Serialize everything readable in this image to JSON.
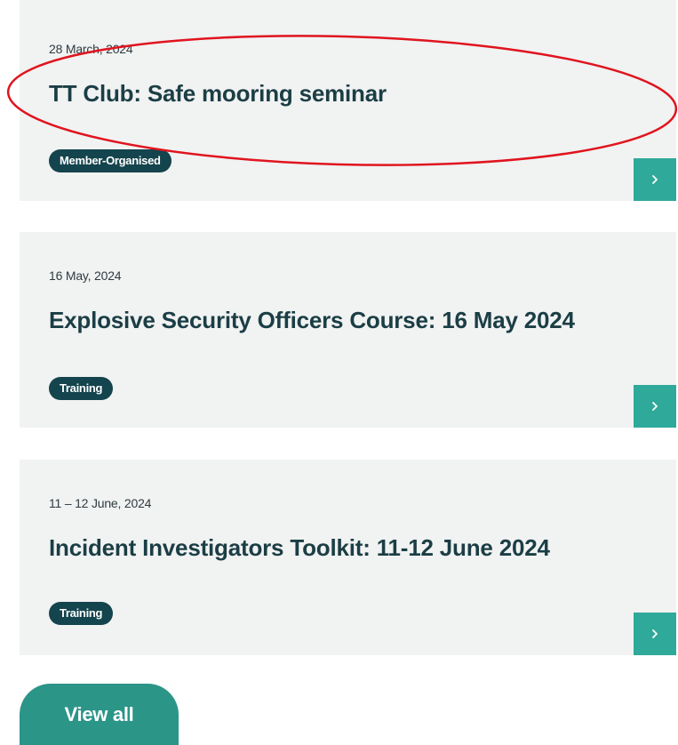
{
  "events": [
    {
      "date": "28 March, 2024",
      "title": "TT Club: Safe mooring seminar",
      "tag": "Member-Organised"
    },
    {
      "date": "16 May, 2024",
      "title": "Explosive Security Officers Course: 16 May 2024",
      "tag": "Training"
    },
    {
      "date": "11 – 12 June, 2024",
      "title": "Incident Investigators Toolkit: 11-12 June 2024",
      "tag": "Training"
    }
  ],
  "view_all_label": "View all",
  "icons": {
    "card_arrow": "chevron-right-icon"
  },
  "colors": {
    "card_background": "#f1f2f2",
    "title_text": "#1b3e45",
    "tag_background": "#14444d",
    "arrow_button": "#2fa99a",
    "view_all_button": "#2b9588",
    "annotation": "#e0141e"
  }
}
